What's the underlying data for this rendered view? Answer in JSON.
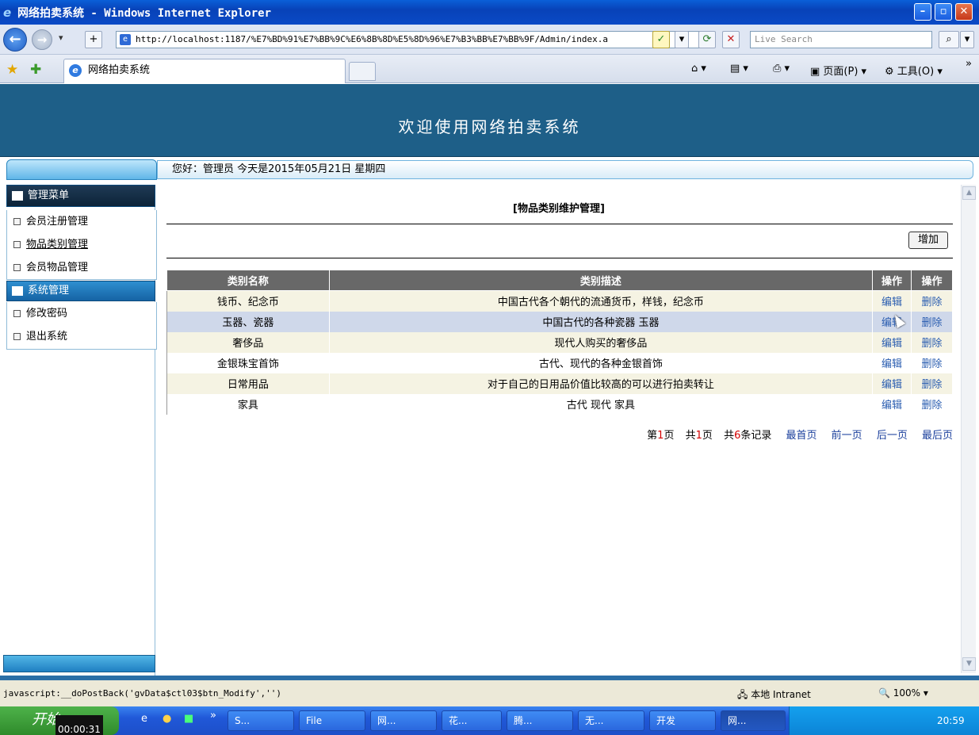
{
  "window": {
    "title": "网络拍卖系统 - Windows Internet Explorer",
    "url": "http://localhost:1187/%E7%BD%91%E7%BB%9C%E6%8B%8D%E5%8D%96%E7%B3%BB%E7%BB%9F/Admin/index.a",
    "search_placeholder": "Live Search",
    "tab_label": "网络拍卖系统",
    "page_menu": "页面(P)",
    "tools_menu": "工具(O)"
  },
  "banner": {
    "title": "欢迎使用网络拍卖系统"
  },
  "greeting": "您好：管理员   今天是2015年05月21日   星期四",
  "sidebar": {
    "manage_menu_title": "管理菜单",
    "items": [
      "会员注册管理",
      "物品类别管理",
      "会员物品管理"
    ],
    "system_menu_title": "系统管理",
    "system_items": [
      "修改密码",
      "退出系统"
    ]
  },
  "main": {
    "heading": "[物品类别维护管理]",
    "add_button": "增加",
    "columns": [
      "类别名称",
      "类别描述",
      "操作",
      "操作"
    ],
    "rows": [
      {
        "name": "钱币、纪念币",
        "desc": "中国古代各个朝代的流通货币，样钱，纪念币",
        "edit": "编辑",
        "delete": "删除"
      },
      {
        "name": "玉器、瓷器",
        "desc": "中国古代的各种瓷器 玉器",
        "edit": "编辑",
        "delete": "删除"
      },
      {
        "name": "奢侈品",
        "desc": "现代人购买的奢侈品",
        "edit": "编辑",
        "delete": "删除"
      },
      {
        "name": "金银珠宝首饰",
        "desc": "古代、现代的各种金银首饰",
        "edit": "编辑",
        "delete": "删除"
      },
      {
        "name": "日常用品",
        "desc": "对于自己的日用品价值比较高的可以进行拍卖转让",
        "edit": "编辑",
        "delete": "删除"
      },
      {
        "name": "家具",
        "desc": "古代 现代 家具",
        "edit": "编辑",
        "delete": "删除"
      }
    ],
    "pager": {
      "page_prefix": "第",
      "current_page": "1",
      "page_suffix": "页",
      "total_prefix": "共",
      "total_pages": "1",
      "total_suffix": "页",
      "records_prefix": "共",
      "records": "6",
      "records_suffix": "条记录",
      "first": "最首页",
      "prev": "前一页",
      "next": "后一页",
      "last": "最后页"
    }
  },
  "status": {
    "text": "javascript:__doPostBack('gvData$ctl03$btn_Modify','')",
    "zone": "本地 Intranet",
    "zoom": "100%"
  },
  "taskbar": {
    "start": "开始",
    "timer": "00:00:31",
    "buttons": [
      "S...",
      "File",
      "网...",
      "花...",
      "腾...",
      "无...",
      "开发",
      "网..."
    ],
    "clock": "20:59"
  },
  "colors": {
    "banner": "#1e5f88",
    "grid_header": "#686868",
    "link": "#2a5db0",
    "pager_number": "#d40000"
  }
}
